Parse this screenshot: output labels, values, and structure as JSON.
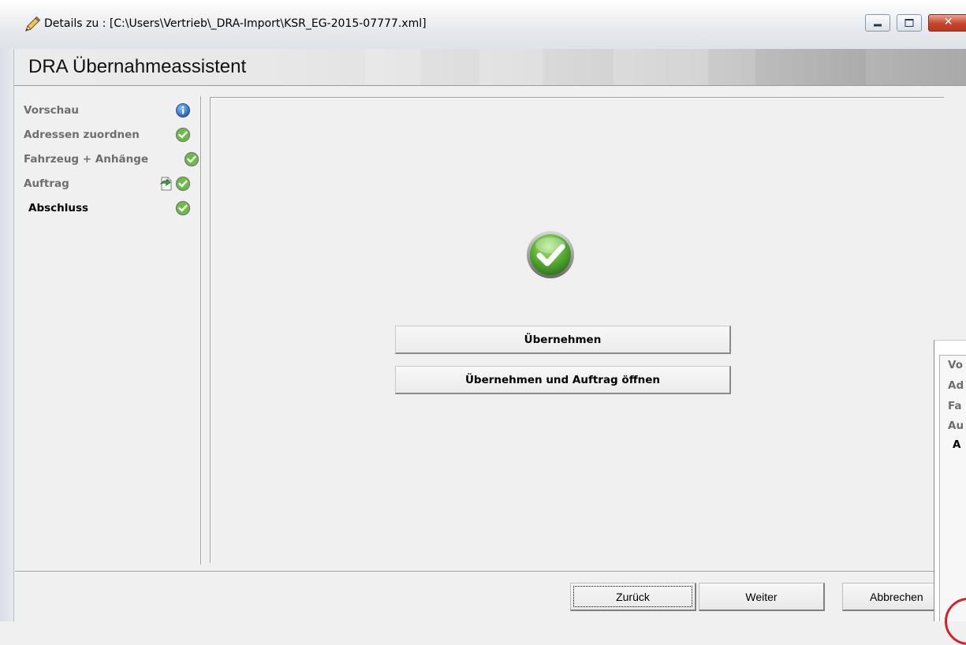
{
  "window": {
    "title": "Details zu : [C:\\Users\\Vertrieb\\_DRA-Import\\KSR_EG-2015-07777.xml]",
    "close_glyph": "✕"
  },
  "header": {
    "title": "DRA Übernahmeassistent"
  },
  "steps": [
    {
      "label": "Vorschau",
      "status": "info-icon"
    },
    {
      "label": "Adressen zuordnen",
      "status": "check-icon"
    },
    {
      "label": "Fahrzeug + Anhänge",
      "status": "check-icon"
    },
    {
      "label": "Auftrag",
      "status": "check-icon",
      "extra": "document-arrow-icon"
    },
    {
      "label": "Abschluss",
      "status": "check-icon",
      "current": true
    }
  ],
  "main": {
    "status_icon": "success-check-icon",
    "buttons": {
      "apply": "Übernehmen",
      "apply_open": "Übernehmen und Auftrag öffnen"
    }
  },
  "footer": {
    "back": "Zurück",
    "next": "Weiter",
    "cancel": "Abbrechen"
  },
  "background_window": {
    "steps": [
      "Vo",
      "Ad",
      "Fa",
      "Au",
      "A"
    ]
  },
  "colors": {
    "check_green": "#5cb135",
    "info_blue": "#2f6fc6",
    "annotation_red": "#d2232a"
  }
}
